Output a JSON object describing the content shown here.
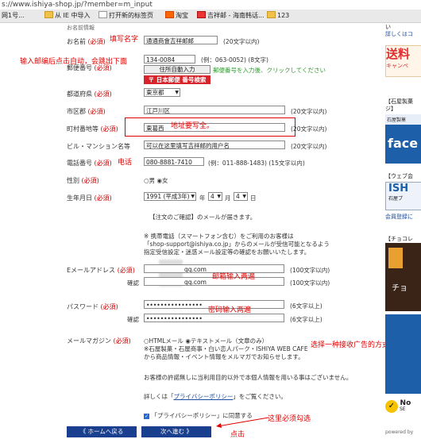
{
  "browser": {
    "url": "s://www.ishiya-shop.jp/?member=m_input",
    "bookmarks": [
      "网1号...",
      "从 IE 中导入",
      "打开新的标签页",
      "淘宝",
      "吉祥邮 - 海南韩话...",
      "123"
    ]
  },
  "form": {
    "section_header": "お名前情報",
    "name": {
      "label": "お名前",
      "required": "(必須)",
      "value": "通通商會吉祥邮邮",
      "hint": "(20文字以内)"
    },
    "postal": {
      "label": "郵便番号",
      "required": "(必須)",
      "value": "134-0084",
      "hint": "(例：063-0052) (8文字)",
      "auto_button": "住所自動入力",
      "auto_hint": "郵便番号を入力後、クリックしてください",
      "jp_search": "日本郵便 番号検索"
    },
    "prefecture": {
      "label": "都道府県",
      "required": "(必須)",
      "value": "東京都"
    },
    "city": {
      "label": "市区郡",
      "required": "(必須)",
      "value": "江戸川区",
      "hint": "(20文字以内)"
    },
    "town": {
      "label": "町村番地等",
      "required": "(必須)",
      "value": "東葛西",
      "hint": "(20文字以内)"
    },
    "building": {
      "label": "ビル・マンション名等",
      "value": "可以在这里填写吉祥邮的用户名",
      "hint": "(20文字以内)"
    },
    "phone": {
      "label": "電話番号",
      "required": "(必須)",
      "value": "080-8881-7410",
      "hint": "(例：011-888-1483) (15文字以内)"
    },
    "gender": {
      "label": "性別",
      "required": "(必須)",
      "male": "男",
      "female": "女"
    },
    "birthday": {
      "label": "生年月日",
      "required": "(必須)",
      "year": "1991 (平成3年)",
      "year_unit": "年",
      "month": "4",
      "month_unit": "月",
      "day": "4",
      "day_unit": "日"
    },
    "confirm_note": "【注文のご確認】のメールが届きます。",
    "mobile_note": [
      "※ 携帯電話（スマートフォン含む）をご利用のお客様は",
      "「shop-support@ishiya.co.jp」からのメールが受信可能となるよう",
      "指定受信設定・迷惑メール設定等の確認をお願いいたします。"
    ],
    "email": {
      "label": "Eメールアドレス",
      "required": "(必須)",
      "value": "qq.com",
      "confirm_label": "確認",
      "confirm_value": "qq.com",
      "hint": "(100文字以内)"
    },
    "password": {
      "label": "パスワード",
      "required": "(必須)",
      "value": "••••••••••••••••",
      "confirm_label": "確認",
      "confirm_value": "••••••••••••••••",
      "hint": "(6文字以上)"
    },
    "magazine": {
      "label": "メールマガジン",
      "required": "(必須)",
      "html": "HTMLメール",
      "text": "テキストメール（文章のみ）",
      "desc": [
        "※石屋製菓・石屋商事・白い恋人パーク・ISHIYA WEB CAFE",
        "から商品情報・イベント情報をメルマガでお知らせします。"
      ]
    },
    "privacy_text": "お客様の許諾無しに当利用目的以外で本個人情報を用いる事はございません。",
    "privacy_detail_prefix": "詳しくは「",
    "privacy_link": "プライバシーポリシー",
    "privacy_detail_suffix": "」をご覧ください。",
    "agree_label": "「プライバシーポリシー」に同意する",
    "back_button": "ホームへ戻る",
    "next_button": "次へ進む"
  },
  "annotations": {
    "fill_name": "填写名字",
    "postal_auto": "输入邮编后点击自动，会跳出下面",
    "address": "地址要写全。",
    "phone": "电话",
    "email_twice": "邮箱输入两遍",
    "password_twice": "密码输入两遍",
    "ad_method": "选择一种接收广告的方式",
    "must_check": "这里必须勾选",
    "click": "点击"
  },
  "sidebar": {
    "top_text": [
      "い",
      "詳しくはコ"
    ],
    "shipping": "送料",
    "campaign": "キャンペ",
    "section1": "【石屋製菓",
    "section1b": "ジ】",
    "section1c": "石屋製菓",
    "facebook": "face",
    "section2": "【ウェブ会",
    "ishiya": "ISH",
    "ishiya_sub": "石屋プ",
    "member_login": "会員登録に",
    "section3": "【チョコレ",
    "choco": "チョ",
    "norton": "No",
    "norton_sub": "SE",
    "powered": "powered by"
  },
  "colors": {
    "accent": "#e00000",
    "button": "#1a3f8f",
    "sidebar_blue": "#1d5fa8",
    "shipping_red": "#e03030"
  }
}
